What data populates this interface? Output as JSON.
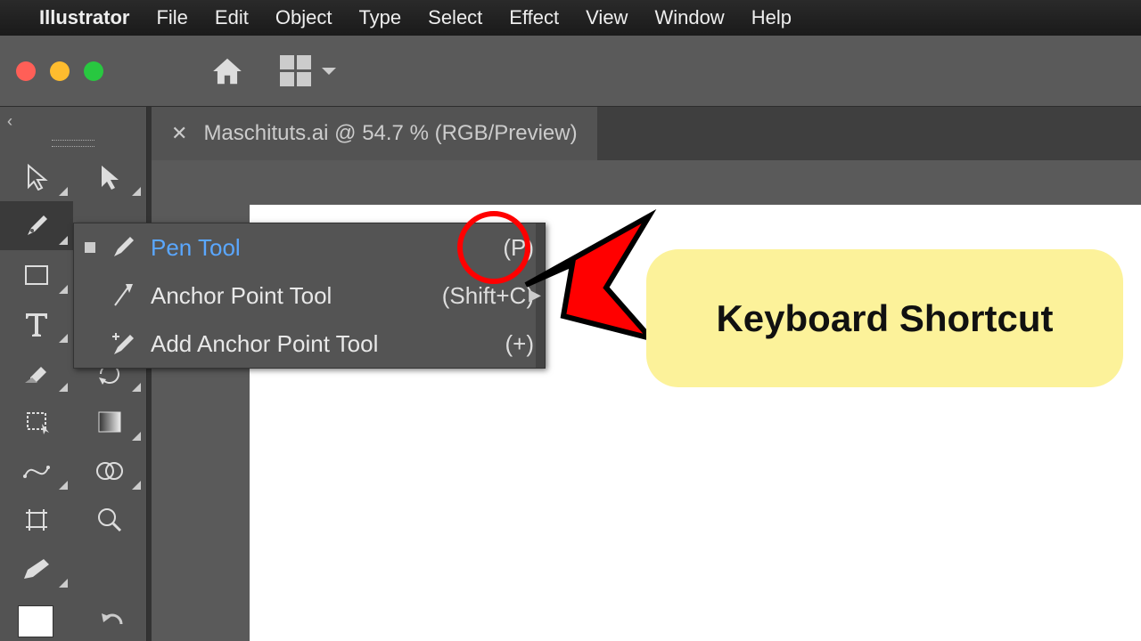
{
  "menubar": {
    "app": "Illustrator",
    "items": [
      "File",
      "Edit",
      "Object",
      "Type",
      "Select",
      "Effect",
      "View",
      "Window",
      "Help"
    ]
  },
  "tab": {
    "title": "Maschituts.ai @ 54.7 % (RGB/Preview)"
  },
  "flyout": {
    "items": [
      {
        "label": "Pen Tool",
        "shortcut": "(P)",
        "selected": true,
        "icon": "pen"
      },
      {
        "label": "Anchor Point Tool",
        "shortcut": "(Shift+C)",
        "selected": false,
        "icon": "anchor"
      },
      {
        "label": "Add Anchor Point Tool",
        "shortcut": "(+)",
        "selected": false,
        "icon": "penplus"
      }
    ]
  },
  "callout": {
    "text": "Keyboard Shortcut"
  }
}
